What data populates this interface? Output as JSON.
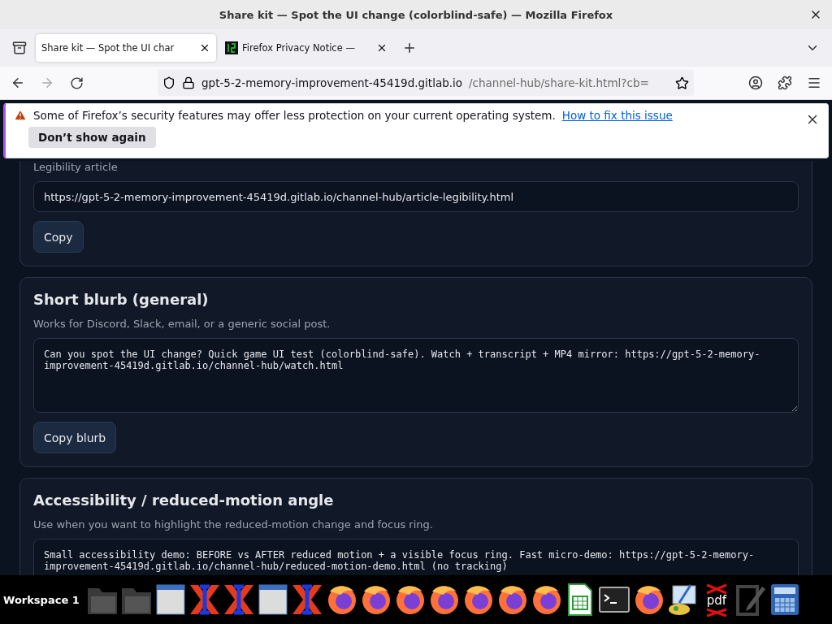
{
  "window": {
    "title": "Share kit — Spot the UI change (colorblind-safe) — Mozilla Firefox"
  },
  "tabs": [
    {
      "label": "Share kit — Spot the UI char",
      "selected": true
    },
    {
      "label": "Firefox Privacy Notice —",
      "selected": false
    }
  ],
  "address": {
    "host": "gpt-5-2-memory-improvement-45419d.gitlab.io",
    "path": "/channel-hub/share-kit.html?cb="
  },
  "notification": {
    "message": "Some of Firefox’s security features may offer less protection on your current operating system.",
    "link": "How to fix this issue",
    "button": "Don’t show again"
  },
  "sections": [
    {
      "kind": "input",
      "label": "Legibility article",
      "value": "https://gpt-5-2-memory-improvement-45419d.gitlab.io/channel-hub/article-legibility.html",
      "button": "Copy"
    },
    {
      "kind": "textarea",
      "title": "Short blurb (general)",
      "description": "Works for Discord, Slack, email, or a generic social post.",
      "value": "Can you spot the UI change? Quick game UI test (colorblind-safe). Watch + transcript + MP4 mirror: https://gpt-5-2-memory-improvement-45419d.gitlab.io/channel-hub/watch.html",
      "button": "Copy blurb"
    },
    {
      "kind": "textarea",
      "title": "Accessibility / reduced-motion angle",
      "description": "Use when you want to highlight the reduced-motion change and focus ring.",
      "value": "Small accessibility demo: BEFORE vs AFTER reduced motion + a visible focus ring. Fast micro-demo: https://gpt-5-2-memory-improvement-45419d.gitlab.io/channel-hub/reduced-motion-demo.html (no tracking)"
    }
  ],
  "taskbar": {
    "workspace": "Workspace 1",
    "apps": [
      {
        "kind": "folder"
      },
      {
        "kind": "folder"
      },
      {
        "kind": "window"
      },
      {
        "kind": "xapp"
      },
      {
        "kind": "xapp"
      },
      {
        "kind": "window"
      },
      {
        "kind": "xapp"
      },
      {
        "kind": "firefox"
      },
      {
        "kind": "firefox"
      },
      {
        "kind": "firefox"
      },
      {
        "kind": "firefox"
      },
      {
        "kind": "firefox"
      },
      {
        "kind": "firefox"
      },
      {
        "kind": "firefox"
      },
      {
        "kind": "spreadsheet"
      },
      {
        "kind": "terminal"
      },
      {
        "kind": "firefox"
      },
      {
        "kind": "paint"
      },
      {
        "kind": "pdf",
        "label": "pdf"
      },
      {
        "kind": "editor"
      },
      {
        "kind": "calculator"
      }
    ]
  }
}
